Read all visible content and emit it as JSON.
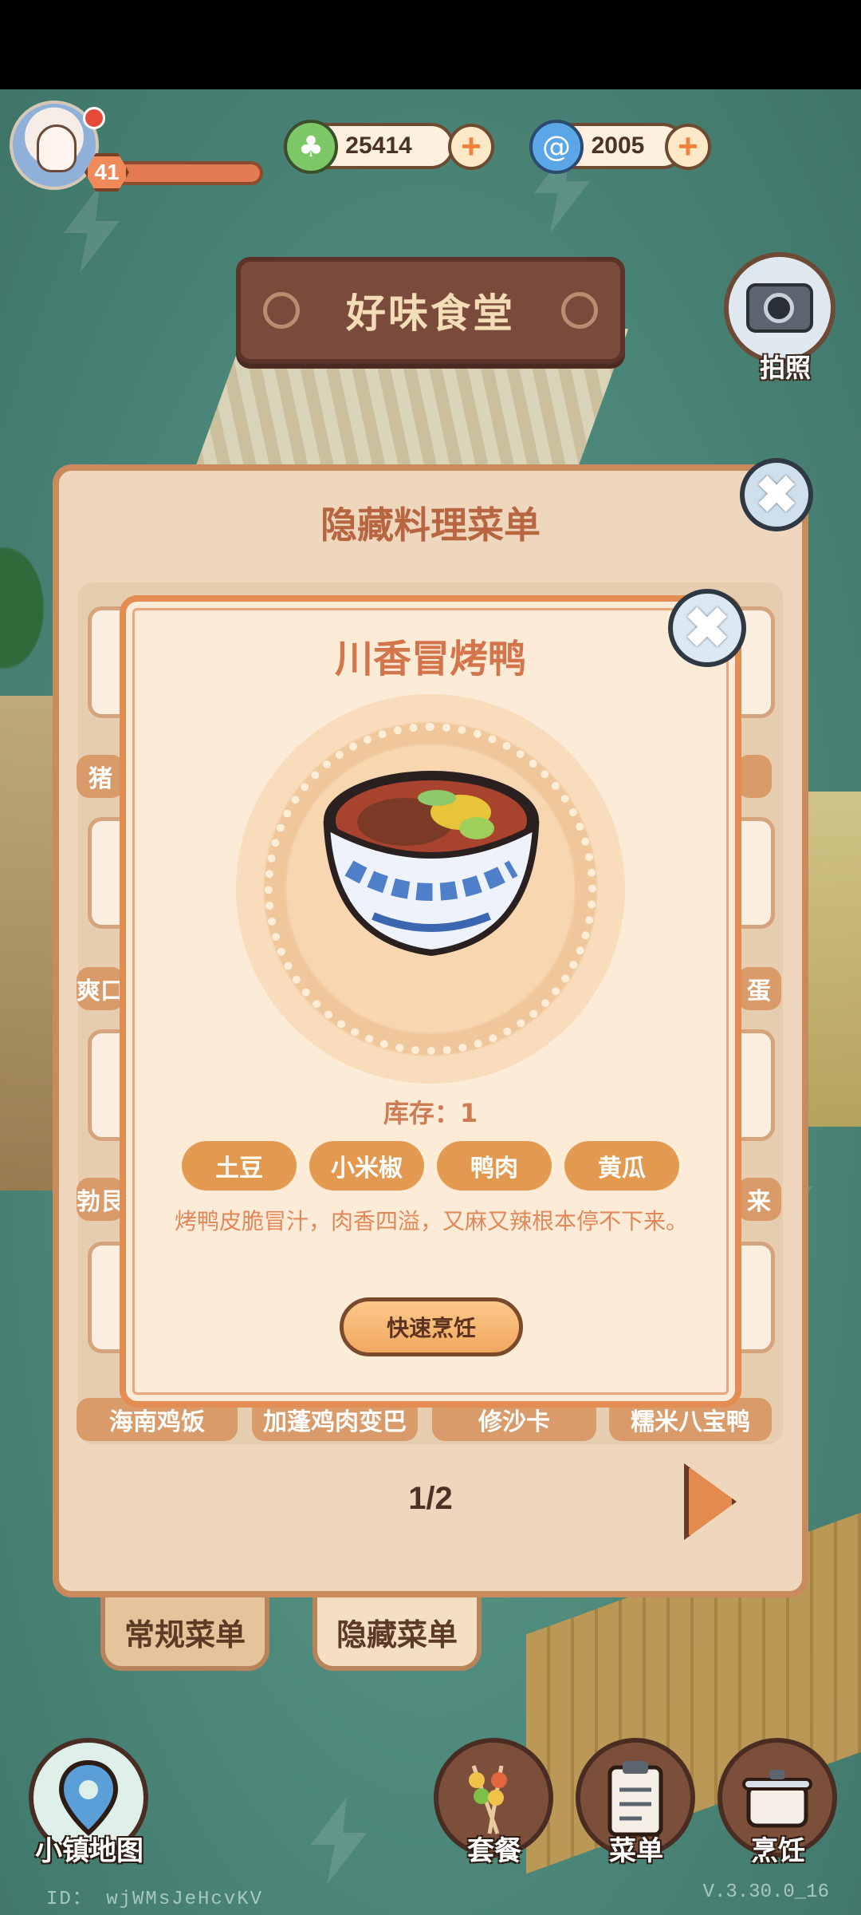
{
  "hud": {
    "level": "41",
    "currency_green": "25414",
    "currency_blue": "2005",
    "plus_symbol": "+"
  },
  "title_sign": "好味食堂",
  "camera_label": "拍照",
  "back_panel": {
    "title": "隐藏料理菜单",
    "close_symbol": "✖",
    "partial_labels": [
      "猪",
      "爽口",
      "蛋",
      "勃艮",
      "来"
    ],
    "bottom_labels": [
      "海南鸡饭",
      "加蓬鸡肉变巴",
      "修沙卡",
      "糯米八宝鸭"
    ],
    "pager": "1/2"
  },
  "tabs": [
    {
      "label": "常规菜单",
      "active": false
    },
    {
      "label": "隐藏菜单",
      "active": true
    }
  ],
  "modal": {
    "title": "川香冒烤鸭",
    "close_symbol": "✖",
    "stock": "库存：1",
    "ingredients": [
      "土豆",
      "小米椒",
      "鸭肉",
      "黄瓜"
    ],
    "description": "烤鸭皮脆冒汁，肉香四溢，又麻又辣根本停不下来。",
    "cook_button": "快速烹饪"
  },
  "nav": {
    "map": "小镇地图",
    "combo": "套餐",
    "menu": "菜单",
    "cook": "烹饪"
  },
  "footer": {
    "id": "ID： wjWMsJeHcvKV",
    "version": "V.3.30.0_16"
  },
  "colors": {
    "accent_orange": "#e3994f",
    "panel_bg": "#fcebd6",
    "scene_green": "#4d8a7c"
  }
}
